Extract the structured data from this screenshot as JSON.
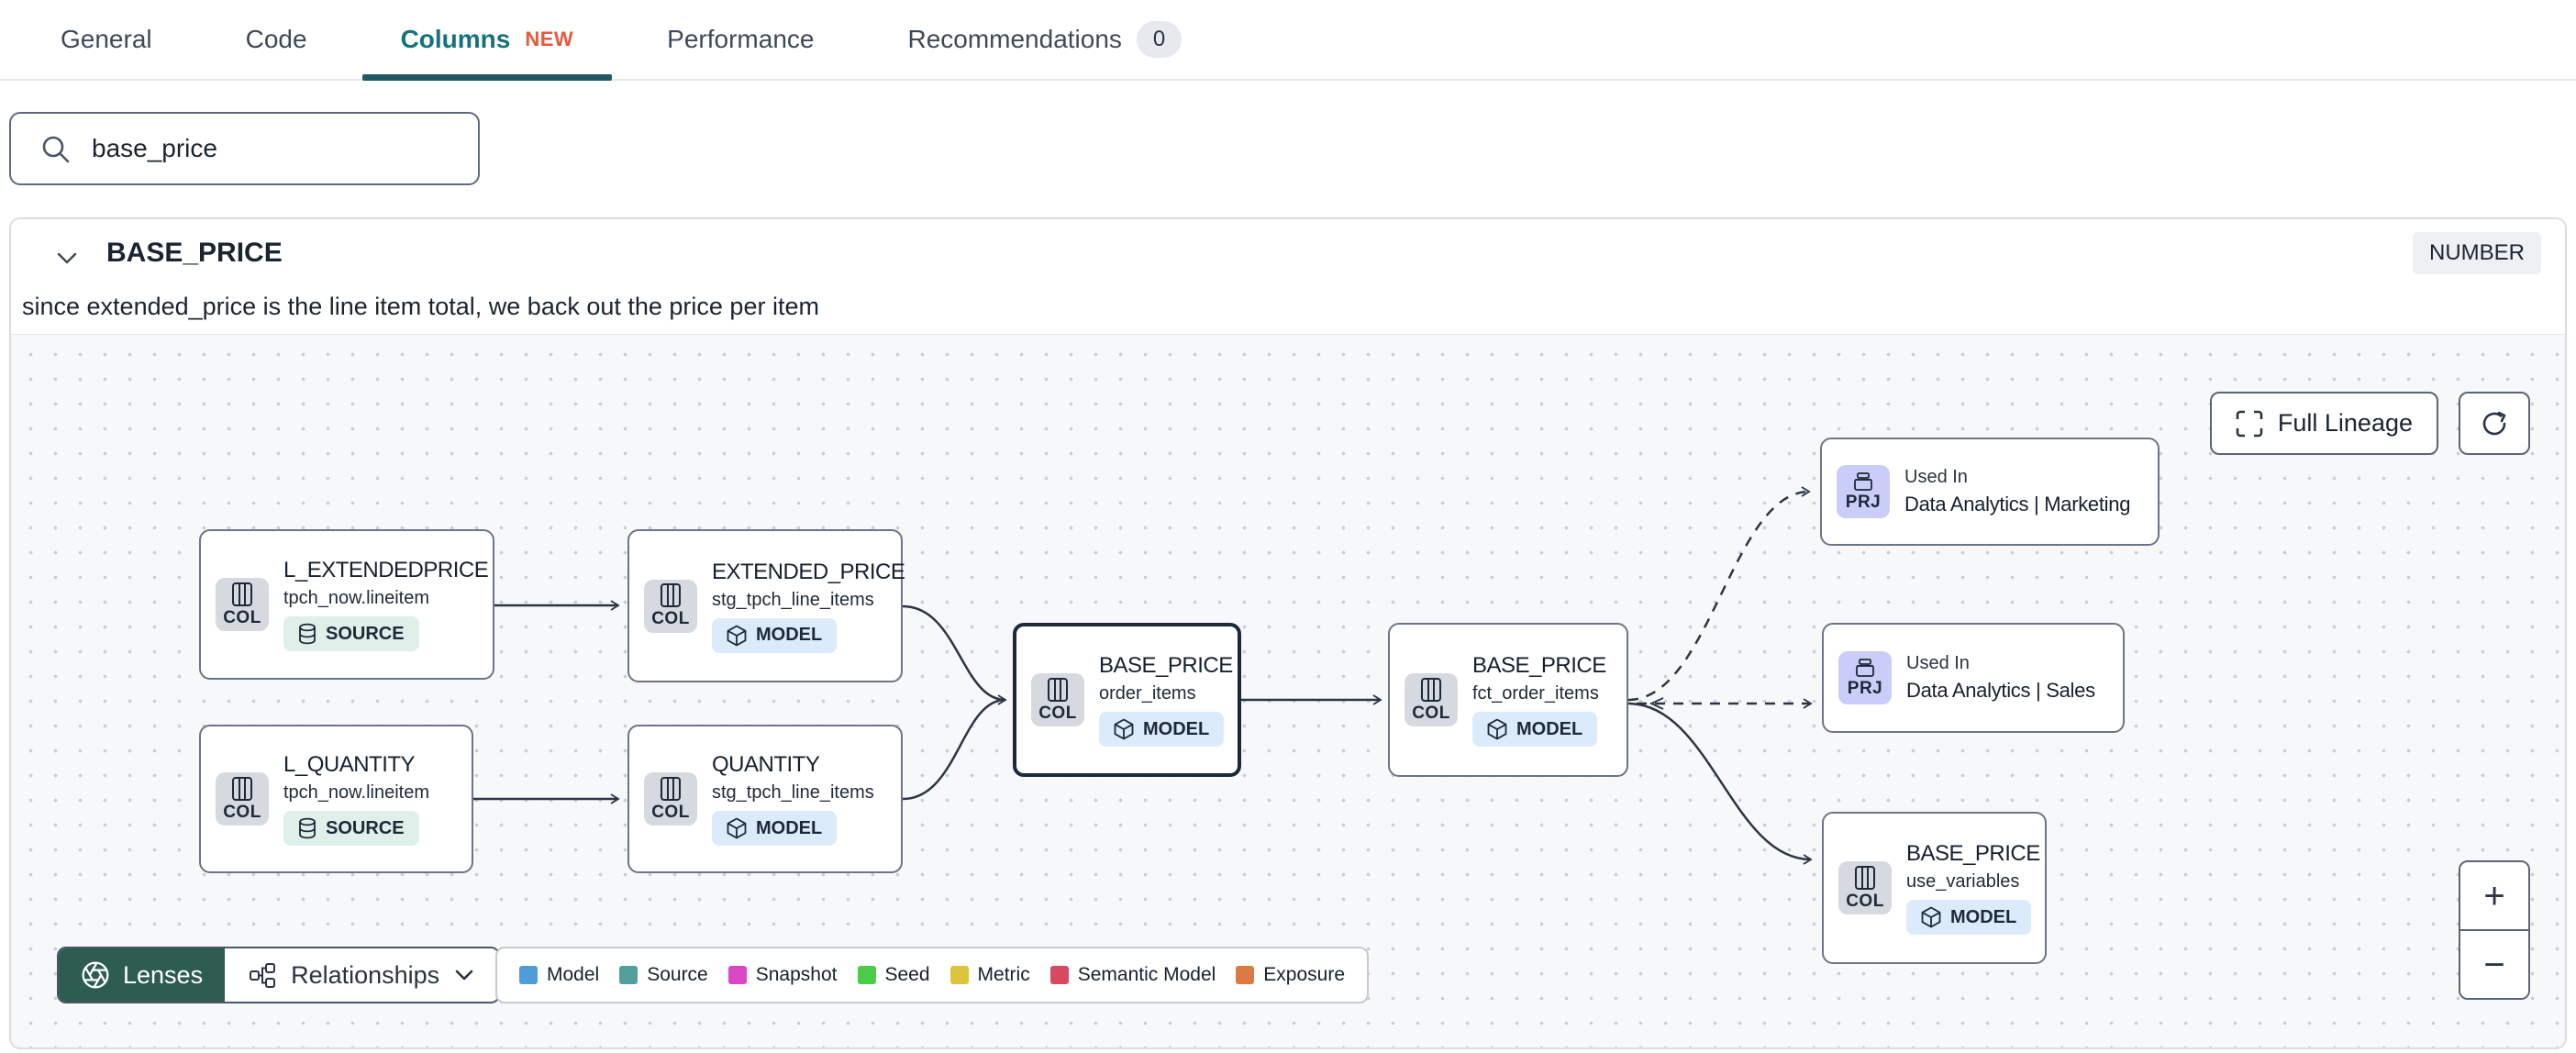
{
  "tabs": {
    "items": [
      {
        "label": "General"
      },
      {
        "label": "Code"
      },
      {
        "label": "Columns",
        "badge": "NEW"
      },
      {
        "label": "Performance"
      },
      {
        "label": "Recommendations",
        "count": "0"
      }
    ]
  },
  "search": {
    "value": "base_price"
  },
  "column": {
    "name": "BASE_PRICE",
    "type": "NUMBER",
    "description": "since extended_price is the line item total, we back out the price per item"
  },
  "lineage": {
    "toolbar": {
      "full_lineage": "Full Lineage"
    },
    "zoom": {
      "in": "+",
      "out": "−"
    },
    "lenses": "Lenses",
    "relationships": "Relationships",
    "legend": [
      {
        "label": "Model",
        "color": "#4f9cdb"
      },
      {
        "label": "Source",
        "color": "#529e99"
      },
      {
        "label": "Snapshot",
        "color": "#da46c3"
      },
      {
        "label": "Seed",
        "color": "#4bcb47"
      },
      {
        "label": "Metric",
        "color": "#ddc43d"
      },
      {
        "label": "Semantic Model",
        "color": "#d8485f"
      },
      {
        "label": "Exposure",
        "color": "#dc7a45"
      }
    ],
    "nodes": [
      {
        "kind": "COL",
        "title": "L_EXTENDEDPRICE",
        "subtitle": "tpch_now.lineitem",
        "badge": "SOURCE"
      },
      {
        "kind": "COL",
        "title": "L_QUANTITY",
        "subtitle": "tpch_now.lineitem",
        "badge": "SOURCE"
      },
      {
        "kind": "COL",
        "title": "EXTENDED_PRICE",
        "subtitle": "stg_tpch_line_items",
        "badge": "MODEL"
      },
      {
        "kind": "COL",
        "title": "QUANTITY",
        "subtitle": "stg_tpch_line_items",
        "badge": "MODEL"
      },
      {
        "kind": "COL",
        "title": "BASE_PRICE",
        "subtitle": "order_items",
        "badge": "MODEL"
      },
      {
        "kind": "COL",
        "title": "BASE_PRICE",
        "subtitle": "fct_order_items",
        "badge": "MODEL"
      },
      {
        "kind": "PRJ",
        "title": "Used In",
        "subtitle": "Data Analytics | Marketing"
      },
      {
        "kind": "PRJ",
        "title": "Used In",
        "subtitle": "Data Analytics | Sales"
      },
      {
        "kind": "COL",
        "title": "BASE_PRICE",
        "subtitle": "use_variables",
        "badge": "MODEL"
      }
    ]
  },
  "theme": {
    "accent_teal": "#17727b",
    "tab_underline": "#1f5a63",
    "new_badge": "#e8593c",
    "lenses_bg": "#2d5c50",
    "canvas_bg": "#f7f8fa",
    "node_border": "#6b7586",
    "selected_border": "#1d2939",
    "source_badge_bg": "#def0e9",
    "model_badge_bg": "#dcebfb",
    "col_icon_bg": "#d6d9df",
    "prj_icon_bg": "#c9cdf7",
    "edge": "#2b3543"
  }
}
